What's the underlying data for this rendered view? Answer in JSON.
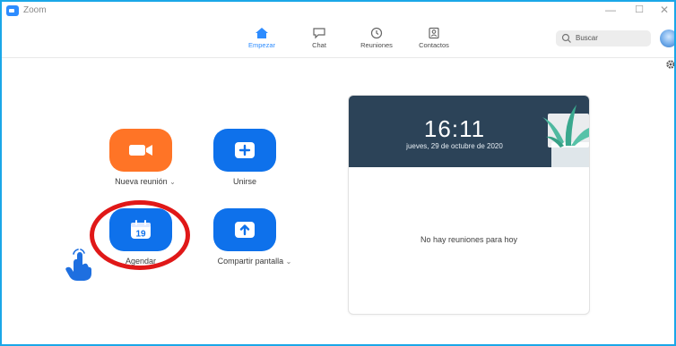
{
  "window": {
    "title": "Zoom",
    "controls": {
      "minimize": "—",
      "maximize": "☐",
      "close": "✕"
    }
  },
  "nav": {
    "tabs": [
      {
        "label": "Empezar",
        "icon": "home-icon",
        "active": true
      },
      {
        "label": "Chat",
        "icon": "chat-icon",
        "active": false
      },
      {
        "label": "Reuniones",
        "icon": "clock-icon",
        "active": false
      },
      {
        "label": "Contactos",
        "icon": "contacts-icon",
        "active": false
      }
    ],
    "search": {
      "placeholder": "Buscar"
    }
  },
  "actions": {
    "new_meeting": {
      "label": "Nueva reunión",
      "caret": "⌄",
      "icon": "video-camera-icon",
      "color": "#ff7426"
    },
    "join": {
      "label": "Unirse",
      "icon": "plus-icon",
      "color": "#0e71eb"
    },
    "schedule": {
      "label": "Agendar",
      "day": "19",
      "icon": "calendar-icon",
      "color": "#0e71eb"
    },
    "share_screen": {
      "label": "Compartir pantalla",
      "caret": "⌄",
      "icon": "share-arrow-icon",
      "color": "#0e71eb"
    }
  },
  "annotation": {
    "highlight": "red-ring",
    "color": "#e01818",
    "pointer": "tap-hand-icon"
  },
  "meetings_card": {
    "time": "16:11",
    "date": "jueves, 29 de octubre de 2020",
    "empty_message": "No hay reuniones para hoy",
    "header_color": "#2c4358"
  },
  "colors": {
    "accent": "#2d8cff",
    "frame_border": "#1aa7e8"
  }
}
